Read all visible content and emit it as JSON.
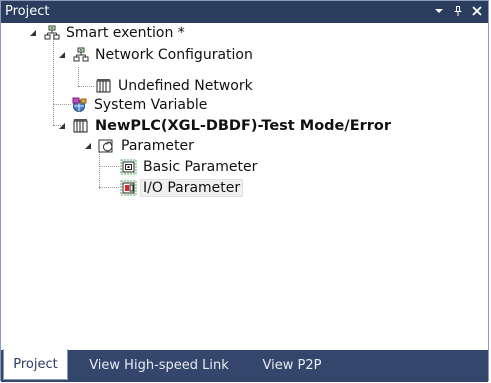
{
  "panel": {
    "title": "Project",
    "controls": {
      "dropdown": "▾",
      "pin": "ꟷ",
      "close": "✕"
    }
  },
  "tree": {
    "root": {
      "label": "Smart exention *",
      "expanded": true
    },
    "network_config": {
      "label": "Network Configuration",
      "expanded": true
    },
    "undefined_network": {
      "label": "Undefined Network"
    },
    "system_variable": {
      "label": "System Variable"
    },
    "plc": {
      "label": "NewPLC(XGL-DBDF)-Test Mode/Error",
      "expanded": true
    },
    "parameter": {
      "label": "Parameter",
      "expanded": true
    },
    "basic_parameter": {
      "label": "Basic Parameter"
    },
    "io_parameter": {
      "label": "I/O Parameter",
      "selected": true
    }
  },
  "tabs": [
    {
      "label": "Project",
      "active": true
    },
    {
      "label": "View High-speed Link",
      "active": false
    },
    {
      "label": "View P2P",
      "active": false
    }
  ],
  "colors": {
    "titlebar": "#2a3d5e",
    "tabbar": "#34466b",
    "tree_bg": "#ffffff"
  }
}
